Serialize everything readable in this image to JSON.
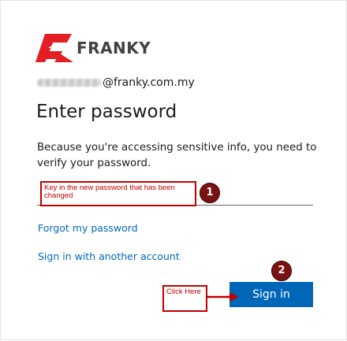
{
  "brand": {
    "name": "FRANKY",
    "accent_color": "#e31e24",
    "text_color": "#414141"
  },
  "identity": {
    "email_suffix": "@franky.com.my"
  },
  "page": {
    "title": "Enter password",
    "description": "Because you're accessing sensitive info, you need to verify your password."
  },
  "password_field": {
    "value": "",
    "placeholder": ""
  },
  "links": {
    "forgot_password": "Forgot my password",
    "other_account": "Sign in with another account"
  },
  "button": {
    "sign_in": "Sign in",
    "color": "#0067b8"
  },
  "annotations": {
    "callout_1": "Key in the new password that has been changed",
    "badge_1": "1",
    "callout_2": "Click Here",
    "badge_2": "2",
    "color": "#c00000"
  }
}
